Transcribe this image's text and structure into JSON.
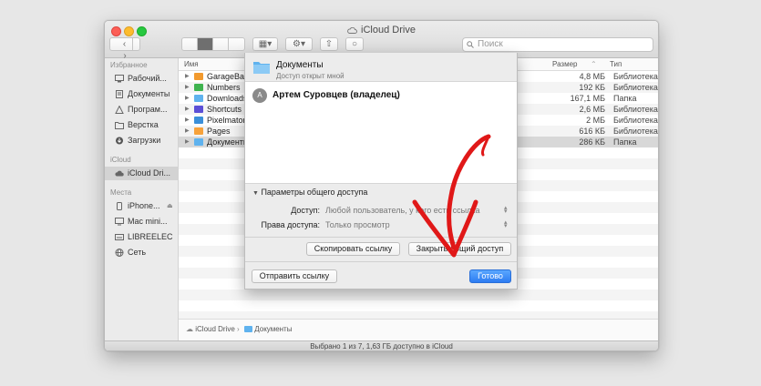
{
  "window": {
    "title": "iCloud Drive"
  },
  "toolbar": {
    "search_placeholder": "Поиск"
  },
  "sidebar": {
    "favorites_label": "Избранное",
    "favorites": [
      {
        "label": "Рабочий...",
        "icon": "desktop-icon"
      },
      {
        "label": "Документы",
        "icon": "document-icon"
      },
      {
        "label": "Програм...",
        "icon": "applications-icon"
      },
      {
        "label": "Верстка",
        "icon": "folder-icon"
      },
      {
        "label": "Загрузки",
        "icon": "downloads-icon"
      }
    ],
    "icloud_label": "iCloud",
    "icloud_items": [
      {
        "label": "iCloud Dri...",
        "icon": "cloud-icon"
      }
    ],
    "places_label": "Места",
    "places": [
      {
        "label": "iPhone...",
        "icon": "phone-icon"
      },
      {
        "label": "Mac mini...",
        "icon": "computer-icon"
      },
      {
        "label": "LIBREELEC",
        "icon": "drive-icon"
      },
      {
        "label": "Сеть",
        "icon": "network-icon"
      }
    ]
  },
  "list": {
    "columns": {
      "name": "Имя",
      "size": "Размер",
      "kind": "Тип"
    },
    "rows": [
      {
        "name": "GarageBand",
        "size": "4,8 МБ",
        "kind": "Библиотека"
      },
      {
        "name": "Numbers",
        "size": "192 КБ",
        "kind": "Библиотека"
      },
      {
        "name": "Downloads",
        "size": "167,1 МБ",
        "kind": "Папка"
      },
      {
        "name": "Shortcuts",
        "size": "2,6 МБ",
        "kind": "Библиотека"
      },
      {
        "name": "Pixelmator",
        "size": "2 МБ",
        "kind": "Библиотека"
      },
      {
        "name": "Pages",
        "size": "616 КБ",
        "kind": "Библиотека"
      },
      {
        "name": "Документы",
        "size": "286 КБ",
        "kind": "Папка"
      }
    ]
  },
  "pathbar": {
    "root": "iCloud Drive",
    "separator": "›",
    "current": "Документы"
  },
  "status": {
    "text": "Выбрано 1 из 7, 1,63 ГБ доступно в iCloud"
  },
  "share_sheet": {
    "folder_name": "Документы",
    "subtitle": "Доступ открыт мной",
    "owner_initial": "А",
    "owner_name": "Артем Суровцев (владелец)",
    "options_header": "Параметры общего доступа",
    "access_label": "Доступ:",
    "access_value": "Любой пользователь, у кого есть ссылка",
    "permission_label": "Права доступа:",
    "permission_value": "Только просмотр",
    "copy_link_button": "Скопировать ссылку",
    "stop_sharing_button": "Закрыть общий доступ",
    "send_link_button": "Отправить ссылку",
    "done_button": "Готово"
  },
  "colors": {
    "accent": "#2d7cf2",
    "annotation_arrow": "#e01818",
    "folder": "#5fb2ee"
  }
}
